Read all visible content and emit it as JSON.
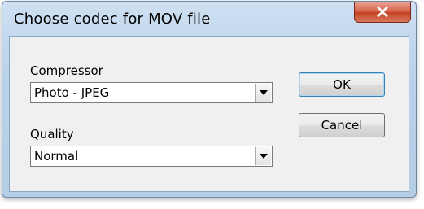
{
  "window": {
    "title": "Choose codec for MOV file"
  },
  "compressor": {
    "label": "Compressor",
    "value": "Photo - JPEG"
  },
  "quality": {
    "label": "Quality",
    "value": "Normal"
  },
  "buttons": {
    "ok_label": "OK",
    "cancel_label": "Cancel"
  },
  "colors": {
    "titlebar": "#b9d1ea",
    "client_background": "#f0f0f0",
    "close_button": "#c34424",
    "default_button_border": "#3c7fb1"
  },
  "icons": {
    "close": "close-icon",
    "dropdown": "chevron-down-icon"
  }
}
